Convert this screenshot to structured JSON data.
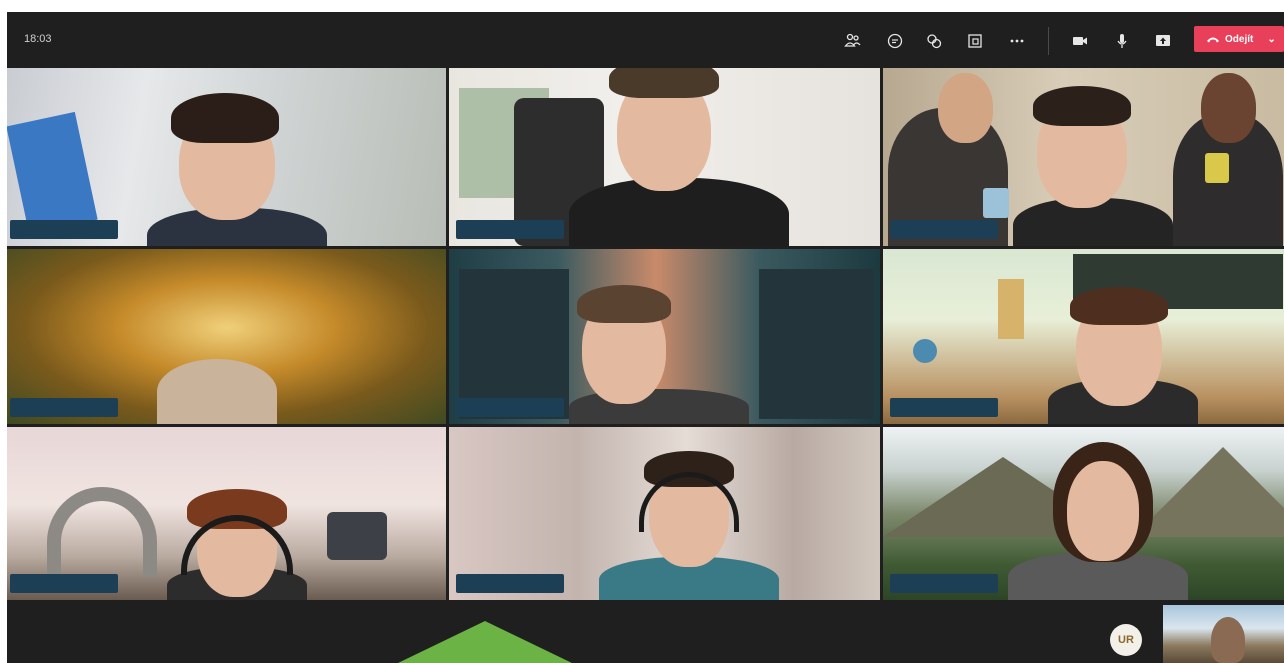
{
  "meeting": {
    "clock": "18:03",
    "leave_label": "Odejít",
    "avatar_initials": "UR"
  },
  "toolbar": {
    "icons": [
      "participants-icon",
      "chat-icon",
      "reactions-icon",
      "share-tray-icon",
      "more-icon",
      "camera-icon",
      "microphone-icon",
      "share-screen-icon"
    ],
    "leave_color": "#e8405a"
  },
  "tiles": [
    {
      "id": "tile-1",
      "background": "office"
    },
    {
      "id": "tile-2",
      "background": "room"
    },
    {
      "id": "tile-3",
      "background": "movie-scene"
    },
    {
      "id": "tile-4",
      "background": "autumn-forest"
    },
    {
      "id": "tile-5",
      "background": "sci-fi-street"
    },
    {
      "id": "tile-6",
      "background": "classroom"
    },
    {
      "id": "tile-7",
      "background": "lunar-landscape"
    },
    {
      "id": "tile-8",
      "background": "blurred"
    },
    {
      "id": "tile-9",
      "background": "mountains"
    }
  ],
  "colors": {
    "frame": "#1f1f1f",
    "namebar": "#1c3f56",
    "highlight_arrow": "#6ab344"
  }
}
